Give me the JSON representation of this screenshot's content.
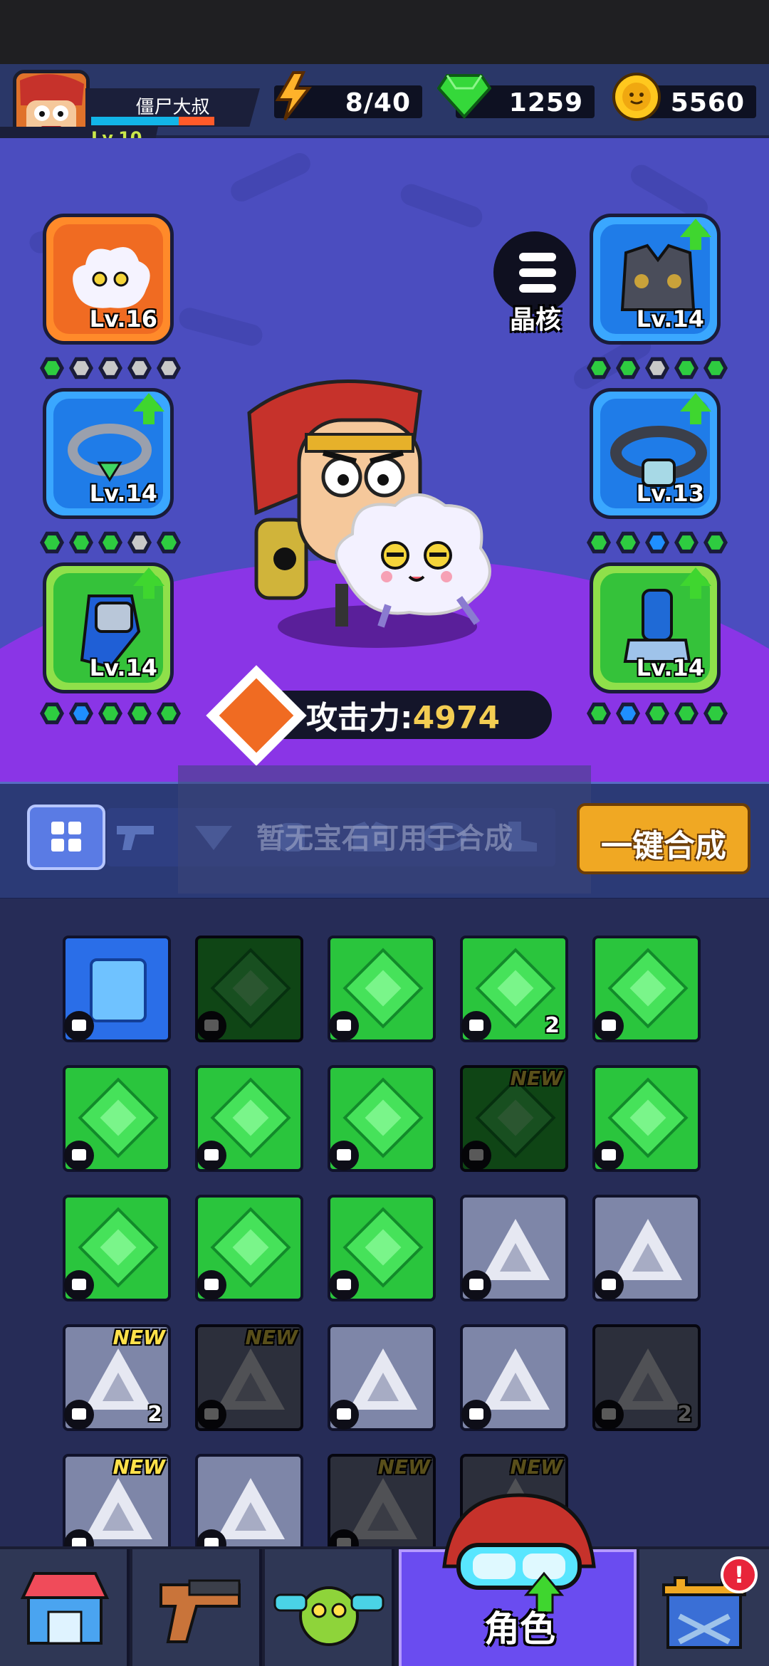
{
  "player": {
    "name": "僵尸大叔",
    "level_label": "Lv.10",
    "xp_fraction": 0.78
  },
  "resources": {
    "energy": "8/40",
    "gems": "1259",
    "coins": "5560"
  },
  "equipment": {
    "left": [
      {
        "name": "cloud-pet",
        "level": "Lv.16",
        "upgrade": false,
        "frame": "#f06b22",
        "inner": "#ffffff",
        "dots": [
          "#2ecc40",
          "#c8c8c8",
          "#c8c8c8",
          "#c8c8c8",
          "#c8c8c8"
        ]
      },
      {
        "name": "chain-necklace",
        "level": "Lv.14",
        "upgrade": true,
        "frame": "#3aa7ff",
        "inner": "#1f7ce8",
        "dots": [
          "#2ecc40",
          "#2ecc40",
          "#2ecc40",
          "#c8c8c8",
          "#2ecc40"
        ]
      },
      {
        "name": "gauntlet",
        "level": "Lv.14",
        "upgrade": true,
        "frame": "#8fe04a",
        "inner": "#35c23a",
        "dots": [
          "#2ecc40",
          "#1f8fff",
          "#2ecc40",
          "#2ecc40",
          "#2ecc40"
        ]
      }
    ],
    "right": [
      {
        "name": "armor-vest",
        "level": "Lv.14",
        "upgrade": true,
        "frame": "#3aa7ff",
        "inner": "#1f7ce8",
        "dots": [
          "#2ecc40",
          "#2ecc40",
          "#c8c8c8",
          "#2ecc40",
          "#2ecc40"
        ]
      },
      {
        "name": "belt",
        "level": "Lv.13",
        "upgrade": true,
        "frame": "#3aa7ff",
        "inner": "#1f7ce8",
        "dots": [
          "#2ecc40",
          "#2ecc40",
          "#1f8fff",
          "#2ecc40",
          "#2ecc40"
        ]
      },
      {
        "name": "boots",
        "level": "Lv.14",
        "upgrade": true,
        "frame": "#8fe04a",
        "inner": "#35c23a",
        "dots": [
          "#2ecc40",
          "#1f8fff",
          "#2ecc40",
          "#2ecc40",
          "#2ecc40"
        ]
      }
    ]
  },
  "core_button": {
    "label": "晶核"
  },
  "attack": {
    "label": "攻击力:",
    "value": "4974"
  },
  "filter": {
    "toast": "暂无宝石可用于合成",
    "merge_button": "一键合成"
  },
  "inventory": [
    {
      "kind": "blue",
      "dim": false,
      "count": "",
      "new": false
    },
    {
      "kind": "green",
      "dim": true,
      "count": "",
      "new": false
    },
    {
      "kind": "green",
      "dim": false,
      "count": "",
      "new": false
    },
    {
      "kind": "green",
      "dim": false,
      "count": "2",
      "new": false
    },
    {
      "kind": "green",
      "dim": false,
      "count": "",
      "new": false
    },
    {
      "kind": "green",
      "dim": false,
      "count": "",
      "new": false
    },
    {
      "kind": "green",
      "dim": false,
      "count": "",
      "new": false
    },
    {
      "kind": "green",
      "dim": false,
      "count": "",
      "new": false
    },
    {
      "kind": "green",
      "dim": true,
      "count": "",
      "new": true
    },
    {
      "kind": "green",
      "dim": false,
      "count": "",
      "new": false
    },
    {
      "kind": "green",
      "dim": false,
      "count": "",
      "new": false
    },
    {
      "kind": "green",
      "dim": false,
      "count": "",
      "new": false
    },
    {
      "kind": "green",
      "dim": false,
      "count": "",
      "new": false
    },
    {
      "kind": "silver",
      "dim": false,
      "count": "",
      "new": false
    },
    {
      "kind": "silver",
      "dim": false,
      "count": "",
      "new": false
    },
    {
      "kind": "silver",
      "dim": false,
      "count": "2",
      "new": true
    },
    {
      "kind": "silver",
      "dim": true,
      "count": "",
      "new": true
    },
    {
      "kind": "silver",
      "dim": false,
      "count": "",
      "new": false
    },
    {
      "kind": "silver",
      "dim": false,
      "count": "",
      "new": false
    },
    {
      "kind": "silver",
      "dim": true,
      "count": "2",
      "new": false
    },
    {
      "kind": "silver",
      "dim": false,
      "count": "",
      "new": true
    },
    {
      "kind": "silver",
      "dim": false,
      "count": "",
      "new": false
    },
    {
      "kind": "silver",
      "dim": true,
      "count": "",
      "new": true
    },
    {
      "kind": "silver",
      "dim": true,
      "count": "",
      "new": true
    }
  ],
  "nav": {
    "tabs": [
      "shop",
      "weapons",
      "pets",
      "character",
      "castle"
    ],
    "active_label": "角色",
    "alert": "!"
  },
  "colors": {
    "arena": "#4b4dbf",
    "dome": "#8a35e6",
    "merge_button": "#f0a823",
    "attack_value": "#f3cd52"
  }
}
